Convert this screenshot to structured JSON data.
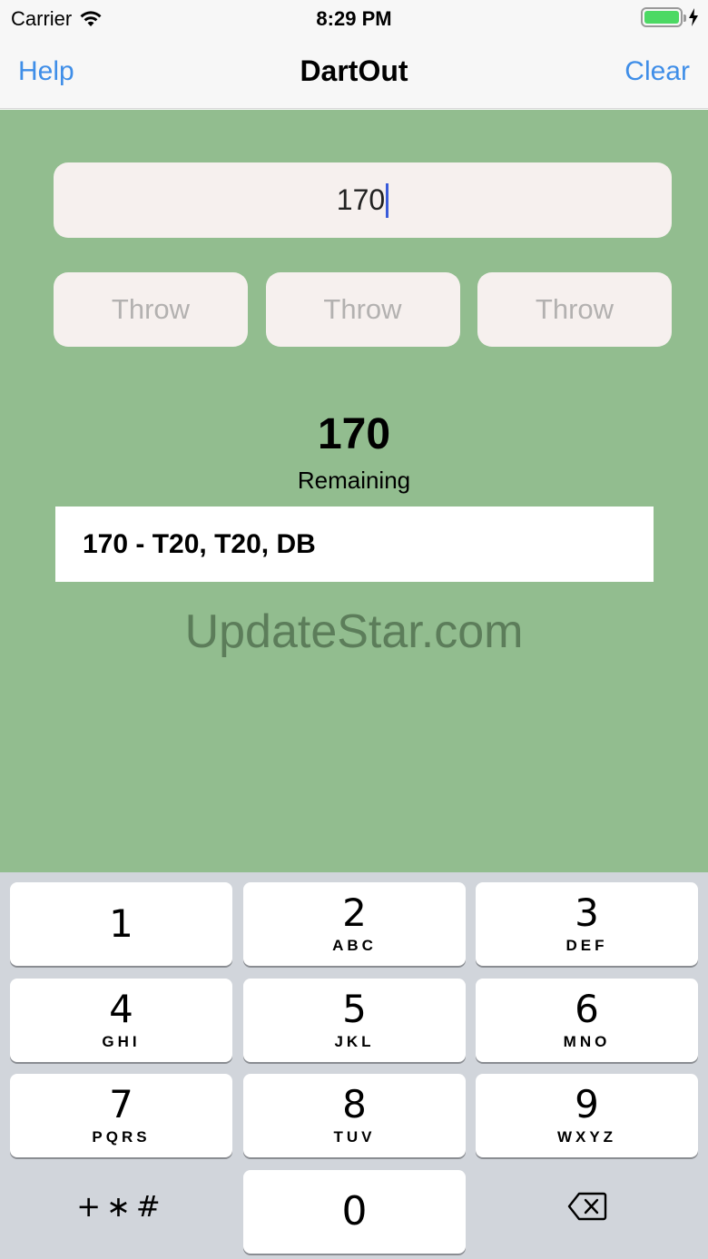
{
  "status": {
    "carrier": "Carrier",
    "time": "8:29 PM"
  },
  "nav": {
    "left": "Help",
    "title": "DartOut",
    "right": "Clear"
  },
  "score_input": {
    "value": "170"
  },
  "throws": [
    "Throw",
    "Throw",
    "Throw"
  ],
  "remaining": {
    "value": "170",
    "label": "Remaining"
  },
  "checkout": "170 - T20, T20, DB",
  "watermark": "UpdateStar.com",
  "keypad": {
    "keys": [
      {
        "digit": "1",
        "letters": ""
      },
      {
        "digit": "2",
        "letters": "ABC"
      },
      {
        "digit": "3",
        "letters": "DEF"
      },
      {
        "digit": "4",
        "letters": "GHI"
      },
      {
        "digit": "5",
        "letters": "JKL"
      },
      {
        "digit": "6",
        "letters": "MNO"
      },
      {
        "digit": "7",
        "letters": "PQRS"
      },
      {
        "digit": "8",
        "letters": "TUV"
      },
      {
        "digit": "9",
        "letters": "WXYZ"
      }
    ],
    "symbols": "+∗#",
    "zero": "0"
  },
  "colors": {
    "accent": "#3f8ee8",
    "background": "#92bd8f",
    "battery": "#4cd964"
  }
}
